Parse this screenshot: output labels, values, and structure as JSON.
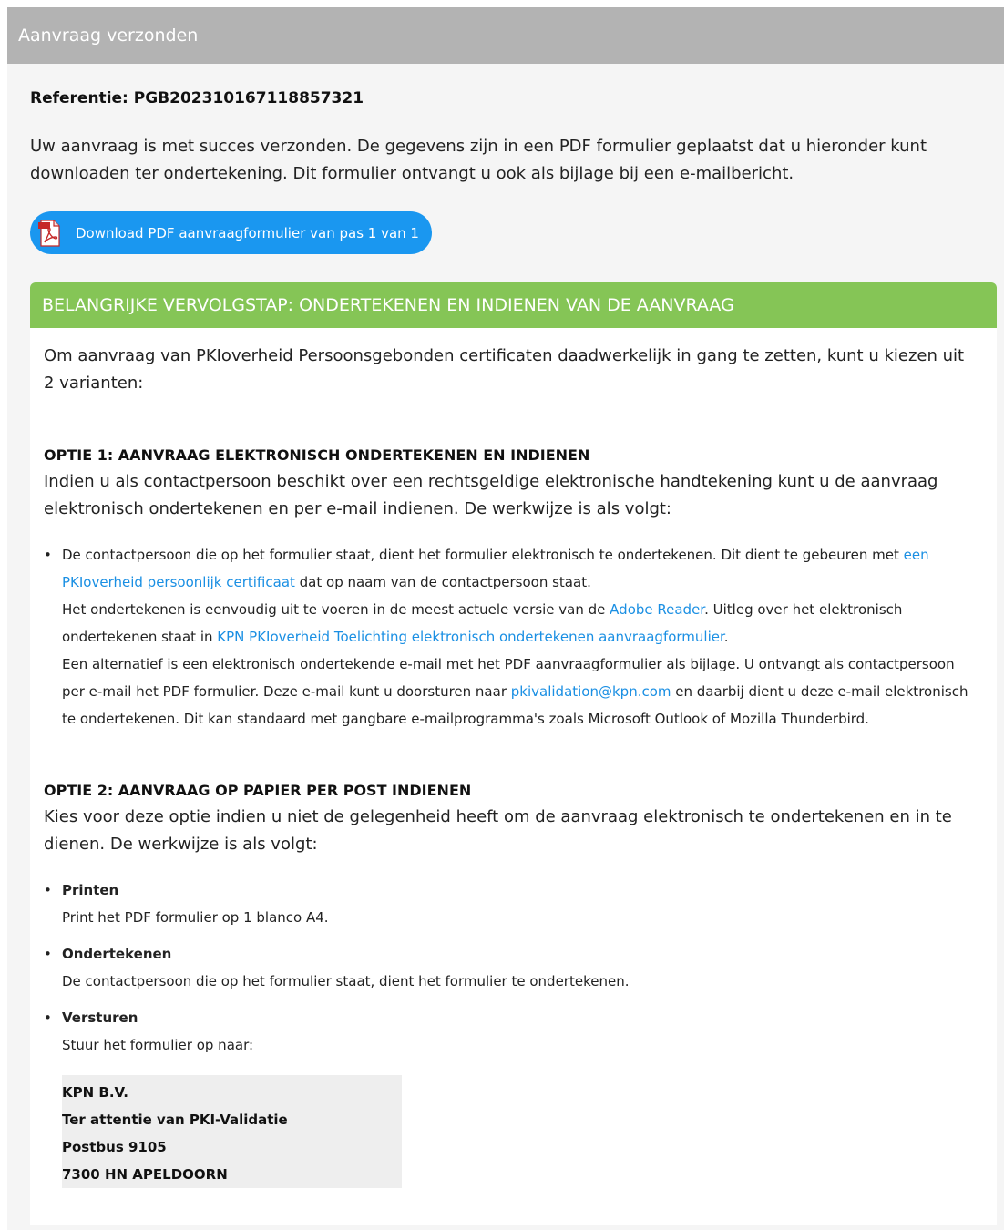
{
  "header": {
    "title": "Aanvraag verzonden"
  },
  "reference": "Referentie: PGB202310167118857321",
  "intro": "Uw aanvraag is met succes verzonden. De gegevens zijn in een PDF formulier geplaatst dat u hieronder kunt downloaden ter ondertekening. Dit formulier ontvangt u ook als bijlage bij een e-mailbericht.",
  "download": {
    "label": "Download PDF aanvraagformulier van pas 1 van 1",
    "icon": "pdf-icon",
    "color": "#1a97f0"
  },
  "step": {
    "title": "BELANGRIJKE VERVOLGSTAP: ONDERTEKENEN EN INDIENEN VAN DE AANVRAAG",
    "color": "#85c556",
    "lead": "Om aanvraag van PKIoverheid Persoonsgebonden certificaten daadwerkelijk in gang te zetten, kunt u kiezen uit 2 varianten:",
    "option1": {
      "title": "OPTIE 1: AANVRAAG ELEKTRONISCH ONDERTEKENEN EN INDIENEN",
      "intro": "Indien u als contactpersoon beschikt over een rechtsgeldige elektronische handtekening kunt u de aanvraag elektronisch ondertekenen en per e-mail indienen. De werkwijze is als volgt:",
      "p1_text": "De contactpersoon die op het formulier staat, dient het formulier elektronisch te ondertekenen. Dit dient te gebeuren met ",
      "p1_link": "een PKIoverheid persoonlijk certificaat",
      "p1_after": " dat op naam van de contactpersoon staat.",
      "p2_text": "Het ondertekenen is eenvoudig uit te voeren in de meest actuele versie van de ",
      "p2_link": "Adobe Reader",
      "p2_mid": ". Uitleg over het elektronisch ondertekenen staat in ",
      "p2_link2": "KPN PKIoverheid Toelichting elektronisch ondertekenen aanvraagformulier",
      "p2_after": ".",
      "p3_text": "Een alternatief is een elektronisch ondertekende e-mail met het PDF aanvraagformulier als bijlage. U ontvangt als contactpersoon per e-mail het PDF formulier. Deze e-mail kunt u doorsturen naar ",
      "p3_link": "pkivalidation@kpn.com",
      "p3_after": " en daarbij dient u deze e-mail elektronisch te ondertekenen. Dit kan standaard met gangbare e-mailprogramma's zoals Microsoft Outlook of Mozilla Thunderbird."
    },
    "option2": {
      "title": "OPTIE 2: AANVRAAG OP PAPIER PER POST INDIENEN",
      "intro": "Kies voor deze optie indien u niet de gelegenheid heeft om de aanvraag elektronisch te ondertekenen en in te dienen. De werkwijze is als volgt:",
      "items": [
        {
          "head": "Printen",
          "text": "Print het PDF formulier op 1 blanco A4."
        },
        {
          "head": "Ondertekenen",
          "text": "De contactpersoon die op het formulier staat, dient het formulier te ondertekenen."
        },
        {
          "head": "Versturen",
          "text": "Stuur het formulier op naar:"
        }
      ],
      "address": [
        "KPN B.V.",
        "Ter attentie van PKI-Validatie",
        "Postbus 9105",
        "7300 HN APELDOORN"
      ]
    }
  }
}
